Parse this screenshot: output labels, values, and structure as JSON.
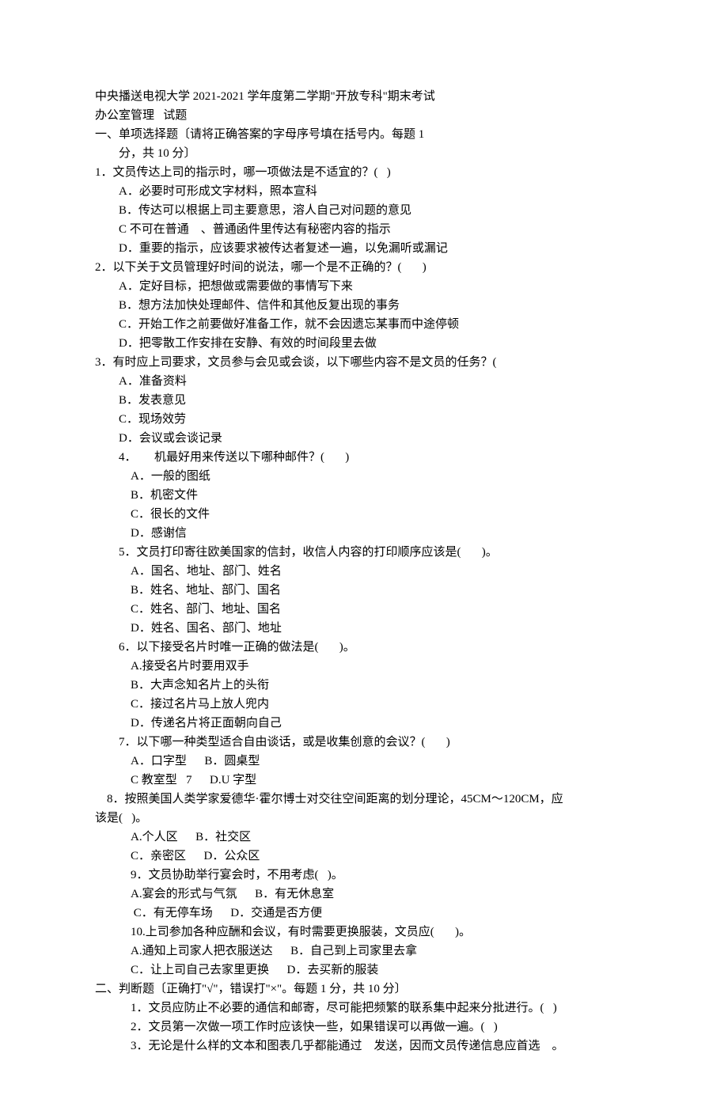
{
  "header": {
    "line1": "中央播送电视大学 2021-2021 学年度第二学期\"开放专科\"期末考试",
    "line2": "办公室管理   试题"
  },
  "section1": {
    "title": "一、单项选择题〔请将正确答案的字母序号填在括号内。每题 1",
    "title_cont": "分，共 10 分〕",
    "q1": {
      "stem": "1．文员传达上司的指示时，哪一项做法是不适宜的？(   )",
      "a": "A．必要时可形成文字材料，照本宣科",
      "b": "B．传达可以根据上司主要意思，溶人自己对问题的意见",
      "c": "C 不可在普通    、普通函件里传达有秘密内容的指示",
      "d": "D．重要的指示，应该要求被传达者复述一遍，以免漏听或漏记"
    },
    "q2": {
      "stem": "2．以下关于文员管理好时间的说法，哪一个是不正确的？(       )",
      "a": "A．定好目标，把想做或需要做的事情写下来",
      "b": "B．想方法加快处理邮件、信件和其他反复出现的事务",
      "c": "C．开始工作之前要做好准备工作，就不会因遗忘某事而中途停顿",
      "d": "D．把零散工作安排在安静、有效的时间段里去做"
    },
    "q3": {
      "stem": "3．有时应上司要求，文员参与会见或会谈，以下哪些内容不是文员的任务？(",
      "a": "A．准备资料",
      "b": "B．发表意见",
      "c": "C．现场效劳",
      "d": "D．会议或会谈记录"
    },
    "q4": {
      "stem": "4．      机最好用来传送以下哪种邮件？(       )",
      "a": "A．一般的图纸",
      "b": "B．机密文件",
      "c": "C．很长的文件",
      "d": "D．感谢信"
    },
    "q5": {
      "stem": "5．文员打印寄往欧美国家的信封，收信人内容的打印顺序应该是(       )。",
      "a": "A．国名、地址、部门、姓名",
      "b": "B．姓名、地址、部门、国名",
      "c": "C．姓名、部门、地址、国名",
      "d": "D．姓名、国名、部门、地址"
    },
    "q6": {
      "stem": "6．以下接受名片时唯一正确的做法是(       )。",
      "a": "A.接受名片时要用双手",
      "b": "B．大声念知名片上的头衔",
      "c": "C．接过名片马上放人兜内",
      "d": "D．传递名片将正面朝向自己"
    },
    "q7": {
      "stem": "7．以下哪一种类型适合自由谈话，或是收集创意的会议？(       )",
      "ab": "A．口字型      B．圆桌型",
      "cd": "C 教室型   7      D.U 字型"
    },
    "q8": {
      "stem1": "    8．按照美国人类学家爱德华·霍尔博士对交往空间距离的划分理论，45CM～120CM，应",
      "stem2": "该是(   )。",
      "ab": "A.个人区      B．社交区",
      "cd": "C．亲密区      D．公众区"
    },
    "q9": {
      "stem": "9．文员协助举行宴会时，不用考虑(   )。",
      "ab": "A.宴会的形式与气氛      B．有无休息室",
      "cd": " C．有无停车场      D．交通是否方便"
    },
    "q10": {
      "stem": "10.上司参加各种应酬和会议，有时需要更换服装，文员应(       )。",
      "ab": "A.通知上司家人把衣服送达      B．自己到上司家里去拿",
      "cd": "C．让上司自己去家里更换      D．去买新的服装"
    }
  },
  "section2": {
    "title": "二、判断题〔正确打\"√\"，错误打\"×\"。每题 1 分，共 10 分〕",
    "q1": "1．文员应防止不必要的通信和邮寄，尽可能把频繁的联系集中起来分批进行。(   )",
    "q2": "2．文员第一次做一项工作时应该快一些，如果错误可以再做一遍。(   )",
    "q3": "3．无论是什么样的文本和图表几乎都能通过    发送，因而文员传递信息应首选    。"
  }
}
